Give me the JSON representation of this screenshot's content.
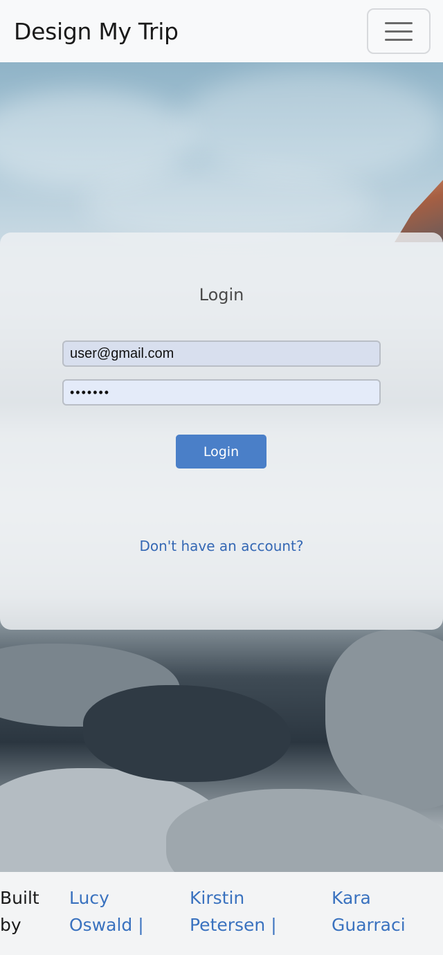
{
  "navbar": {
    "brand": "Design My Trip",
    "toggle_icon": "hamburger-menu-icon"
  },
  "login": {
    "title": "Login",
    "email_value": "user@gmail.com",
    "password_value": "•••••••",
    "submit_label": "Login",
    "signup_link": "Don't have an account?"
  },
  "footer": {
    "built_by": "Built by",
    "authors": [
      "Lucy Oswald |",
      "Kirstin Petersen |",
      "Kara Guarraci"
    ]
  },
  "colors": {
    "accent": "#4a7fc8",
    "link": "#3568b4"
  }
}
